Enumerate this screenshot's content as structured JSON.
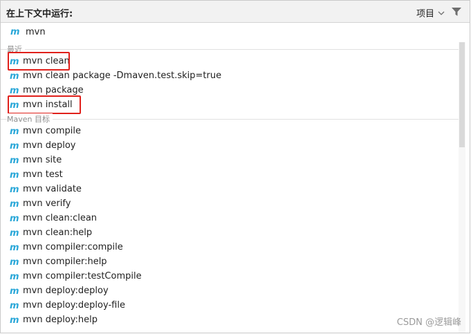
{
  "header": {
    "title": "在上下文中运行:",
    "scope_label": "项目",
    "scope_icon": "chevron-down-icon",
    "filter_icon": "filter-icon"
  },
  "search": {
    "value": "mvn",
    "icon": "maven-icon"
  },
  "sections": {
    "recent": {
      "label": "最近",
      "items": [
        "mvn clean",
        "mvn clean package -Dmaven.test.skip=true",
        "mvn package",
        "mvn install"
      ]
    },
    "maven_goals": {
      "label": "Maven 目标",
      "items": [
        "mvn compile",
        "mvn deploy",
        "mvn site",
        "mvn test",
        "mvn validate",
        "mvn verify",
        "mvn clean:clean",
        "mvn clean:help",
        "mvn compiler:compile",
        "mvn compiler:help",
        "mvn compiler:testCompile",
        "mvn deploy:deploy",
        "mvn deploy:deploy-file",
        "mvn deploy:help"
      ]
    }
  },
  "highlighted_items": [
    "mvn clean",
    "mvn install"
  ],
  "colors": {
    "maven_icon": "#29a7d8",
    "highlight_border": "#e0201b"
  },
  "watermark": "CSDN @逻辑峰"
}
